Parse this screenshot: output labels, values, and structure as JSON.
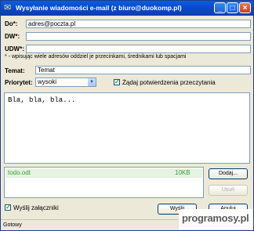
{
  "window": {
    "title": "Wysyłanie wiadomości e-mail (z biuro@duokomp.pl)",
    "controls": {
      "minimize": "_",
      "maximize": "□",
      "close": "×"
    }
  },
  "form": {
    "to_label": "Do*:",
    "to_value": "adres@poczta.pl",
    "cc_label": "DW*:",
    "cc_value": "",
    "bcc_label": "UDW*:",
    "bcc_value": "",
    "hint": "* - wpisując wiele adresów oddziel je przecinkami, średnikami lub spacjami",
    "subject_label": "Temat:",
    "subject_value": "Temat",
    "priority_label": "Priorytet:",
    "priority_value": "wysoki",
    "read_receipt_label": "Żądaj potwierdzenia przeczytania",
    "read_receipt_checked": true,
    "body_text": "Bla, bla, bla..."
  },
  "attachments": {
    "items": [
      {
        "name": "todo.odt",
        "size": "10KB"
      }
    ],
    "add_label": "Dodaj...",
    "remove_label": "Usuń",
    "zip_label": "Wyślij załączniki",
    "zip_checked": true
  },
  "actions": {
    "send_label": "Wyślij",
    "cancel_label": "Anuluj"
  },
  "status": {
    "text": "Gotowy"
  },
  "watermark": {
    "text": "programosy.pl"
  }
}
